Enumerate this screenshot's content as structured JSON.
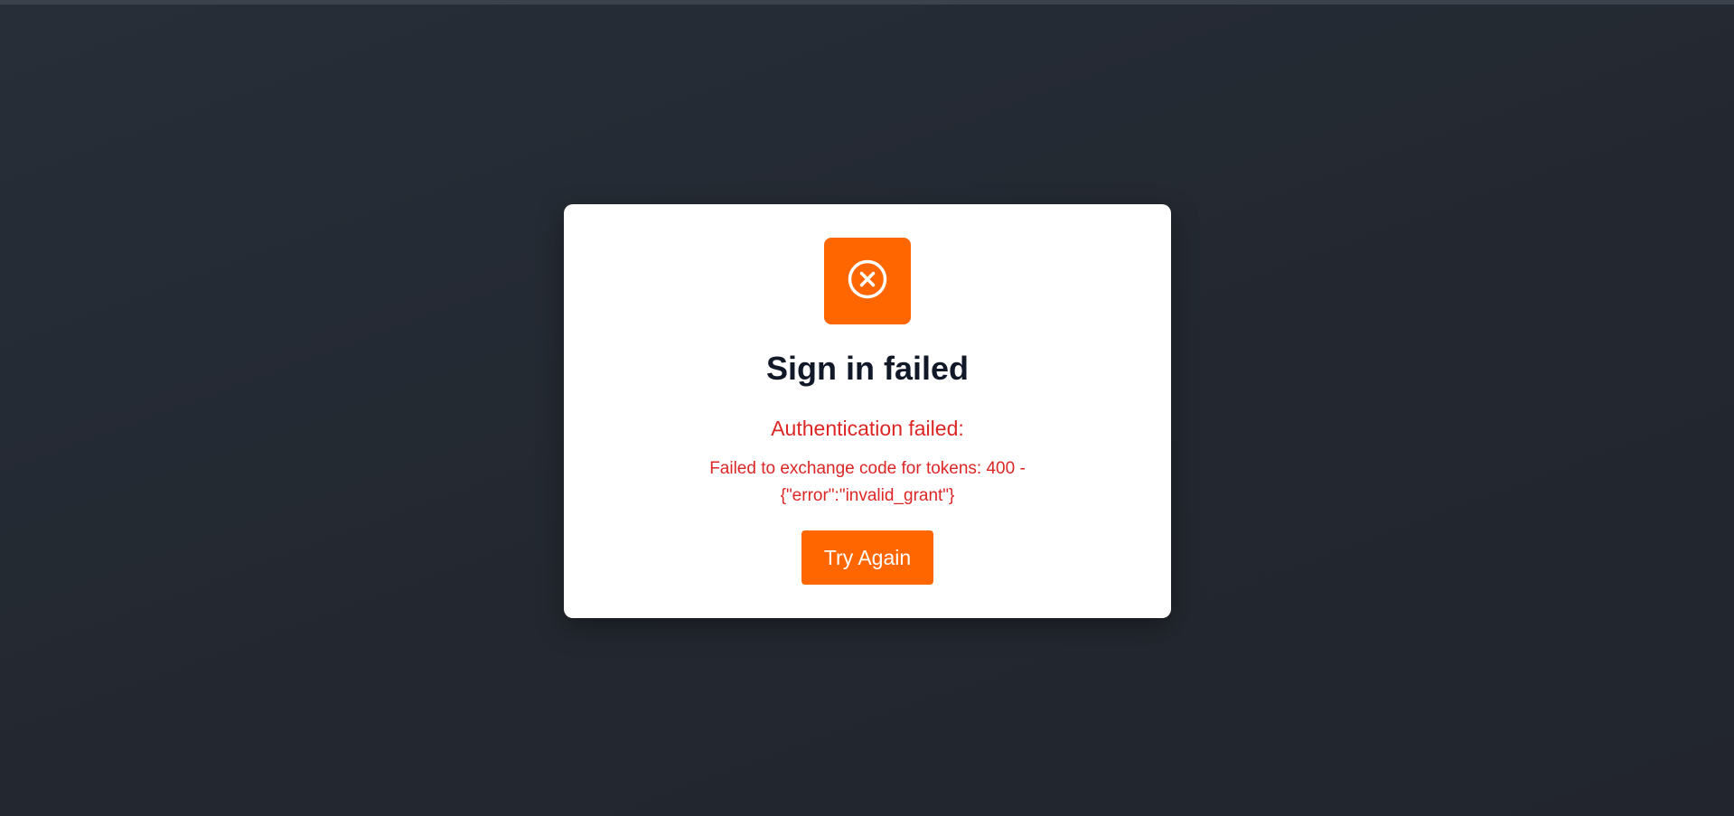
{
  "colors": {
    "accent": "#ff6600",
    "error": "#dc2626",
    "title": "#111827",
    "background": "#252a33",
    "card": "#ffffff"
  },
  "dialog": {
    "icon": "x-circle-icon",
    "title": "Sign in failed",
    "error_heading": "Authentication failed:",
    "error_message": "Failed to exchange code for tokens: 400 - {\"error\":\"invalid_grant\"}",
    "retry_label": "Try Again"
  }
}
